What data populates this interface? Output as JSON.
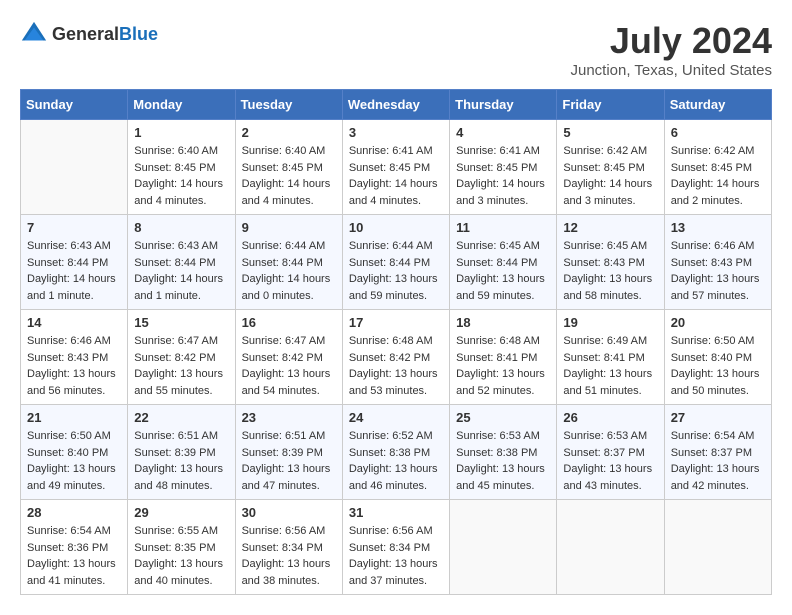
{
  "header": {
    "logo_general": "General",
    "logo_blue": "Blue",
    "main_title": "July 2024",
    "subtitle": "Junction, Texas, United States"
  },
  "days_of_week": [
    "Sunday",
    "Monday",
    "Tuesday",
    "Wednesday",
    "Thursday",
    "Friday",
    "Saturday"
  ],
  "weeks": [
    [
      {
        "day": "",
        "empty": true
      },
      {
        "day": "1",
        "sunrise": "Sunrise: 6:40 AM",
        "sunset": "Sunset: 8:45 PM",
        "daylight": "Daylight: 14 hours and 4 minutes."
      },
      {
        "day": "2",
        "sunrise": "Sunrise: 6:40 AM",
        "sunset": "Sunset: 8:45 PM",
        "daylight": "Daylight: 14 hours and 4 minutes."
      },
      {
        "day": "3",
        "sunrise": "Sunrise: 6:41 AM",
        "sunset": "Sunset: 8:45 PM",
        "daylight": "Daylight: 14 hours and 4 minutes."
      },
      {
        "day": "4",
        "sunrise": "Sunrise: 6:41 AM",
        "sunset": "Sunset: 8:45 PM",
        "daylight": "Daylight: 14 hours and 3 minutes."
      },
      {
        "day": "5",
        "sunrise": "Sunrise: 6:42 AM",
        "sunset": "Sunset: 8:45 PM",
        "daylight": "Daylight: 14 hours and 3 minutes."
      },
      {
        "day": "6",
        "sunrise": "Sunrise: 6:42 AM",
        "sunset": "Sunset: 8:45 PM",
        "daylight": "Daylight: 14 hours and 2 minutes."
      }
    ],
    [
      {
        "day": "7",
        "sunrise": "Sunrise: 6:43 AM",
        "sunset": "Sunset: 8:44 PM",
        "daylight": "Daylight: 14 hours and 1 minute."
      },
      {
        "day": "8",
        "sunrise": "Sunrise: 6:43 AM",
        "sunset": "Sunset: 8:44 PM",
        "daylight": "Daylight: 14 hours and 1 minute."
      },
      {
        "day": "9",
        "sunrise": "Sunrise: 6:44 AM",
        "sunset": "Sunset: 8:44 PM",
        "daylight": "Daylight: 14 hours and 0 minutes."
      },
      {
        "day": "10",
        "sunrise": "Sunrise: 6:44 AM",
        "sunset": "Sunset: 8:44 PM",
        "daylight": "Daylight: 13 hours and 59 minutes."
      },
      {
        "day": "11",
        "sunrise": "Sunrise: 6:45 AM",
        "sunset": "Sunset: 8:44 PM",
        "daylight": "Daylight: 13 hours and 59 minutes."
      },
      {
        "day": "12",
        "sunrise": "Sunrise: 6:45 AM",
        "sunset": "Sunset: 8:43 PM",
        "daylight": "Daylight: 13 hours and 58 minutes."
      },
      {
        "day": "13",
        "sunrise": "Sunrise: 6:46 AM",
        "sunset": "Sunset: 8:43 PM",
        "daylight": "Daylight: 13 hours and 57 minutes."
      }
    ],
    [
      {
        "day": "14",
        "sunrise": "Sunrise: 6:46 AM",
        "sunset": "Sunset: 8:43 PM",
        "daylight": "Daylight: 13 hours and 56 minutes."
      },
      {
        "day": "15",
        "sunrise": "Sunrise: 6:47 AM",
        "sunset": "Sunset: 8:42 PM",
        "daylight": "Daylight: 13 hours and 55 minutes."
      },
      {
        "day": "16",
        "sunrise": "Sunrise: 6:47 AM",
        "sunset": "Sunset: 8:42 PM",
        "daylight": "Daylight: 13 hours and 54 minutes."
      },
      {
        "day": "17",
        "sunrise": "Sunrise: 6:48 AM",
        "sunset": "Sunset: 8:42 PM",
        "daylight": "Daylight: 13 hours and 53 minutes."
      },
      {
        "day": "18",
        "sunrise": "Sunrise: 6:48 AM",
        "sunset": "Sunset: 8:41 PM",
        "daylight": "Daylight: 13 hours and 52 minutes."
      },
      {
        "day": "19",
        "sunrise": "Sunrise: 6:49 AM",
        "sunset": "Sunset: 8:41 PM",
        "daylight": "Daylight: 13 hours and 51 minutes."
      },
      {
        "day": "20",
        "sunrise": "Sunrise: 6:50 AM",
        "sunset": "Sunset: 8:40 PM",
        "daylight": "Daylight: 13 hours and 50 minutes."
      }
    ],
    [
      {
        "day": "21",
        "sunrise": "Sunrise: 6:50 AM",
        "sunset": "Sunset: 8:40 PM",
        "daylight": "Daylight: 13 hours and 49 minutes."
      },
      {
        "day": "22",
        "sunrise": "Sunrise: 6:51 AM",
        "sunset": "Sunset: 8:39 PM",
        "daylight": "Daylight: 13 hours and 48 minutes."
      },
      {
        "day": "23",
        "sunrise": "Sunrise: 6:51 AM",
        "sunset": "Sunset: 8:39 PM",
        "daylight": "Daylight: 13 hours and 47 minutes."
      },
      {
        "day": "24",
        "sunrise": "Sunrise: 6:52 AM",
        "sunset": "Sunset: 8:38 PM",
        "daylight": "Daylight: 13 hours and 46 minutes."
      },
      {
        "day": "25",
        "sunrise": "Sunrise: 6:53 AM",
        "sunset": "Sunset: 8:38 PM",
        "daylight": "Daylight: 13 hours and 45 minutes."
      },
      {
        "day": "26",
        "sunrise": "Sunrise: 6:53 AM",
        "sunset": "Sunset: 8:37 PM",
        "daylight": "Daylight: 13 hours and 43 minutes."
      },
      {
        "day": "27",
        "sunrise": "Sunrise: 6:54 AM",
        "sunset": "Sunset: 8:37 PM",
        "daylight": "Daylight: 13 hours and 42 minutes."
      }
    ],
    [
      {
        "day": "28",
        "sunrise": "Sunrise: 6:54 AM",
        "sunset": "Sunset: 8:36 PM",
        "daylight": "Daylight: 13 hours and 41 minutes."
      },
      {
        "day": "29",
        "sunrise": "Sunrise: 6:55 AM",
        "sunset": "Sunset: 8:35 PM",
        "daylight": "Daylight: 13 hours and 40 minutes."
      },
      {
        "day": "30",
        "sunrise": "Sunrise: 6:56 AM",
        "sunset": "Sunset: 8:34 PM",
        "daylight": "Daylight: 13 hours and 38 minutes."
      },
      {
        "day": "31",
        "sunrise": "Sunrise: 6:56 AM",
        "sunset": "Sunset: 8:34 PM",
        "daylight": "Daylight: 13 hours and 37 minutes."
      },
      {
        "day": "",
        "empty": true
      },
      {
        "day": "",
        "empty": true
      },
      {
        "day": "",
        "empty": true
      }
    ]
  ]
}
